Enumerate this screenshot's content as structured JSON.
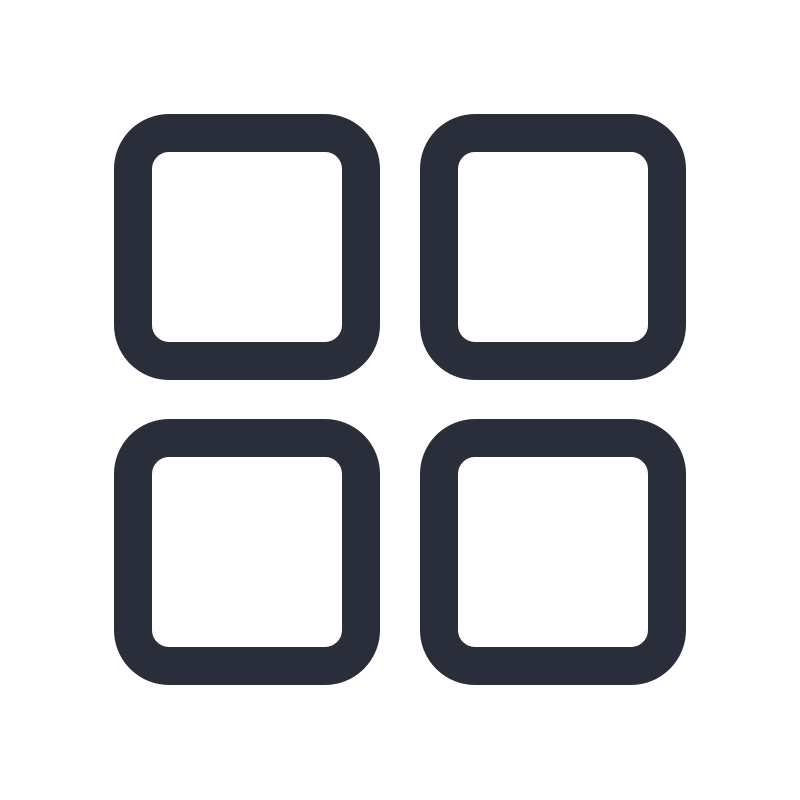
{
  "icon": {
    "name": "grid-icon",
    "color": "#2a2e3b",
    "background": "#ffffff",
    "tiles": [
      "top-left",
      "top-right",
      "bottom-left",
      "bottom-right"
    ]
  }
}
